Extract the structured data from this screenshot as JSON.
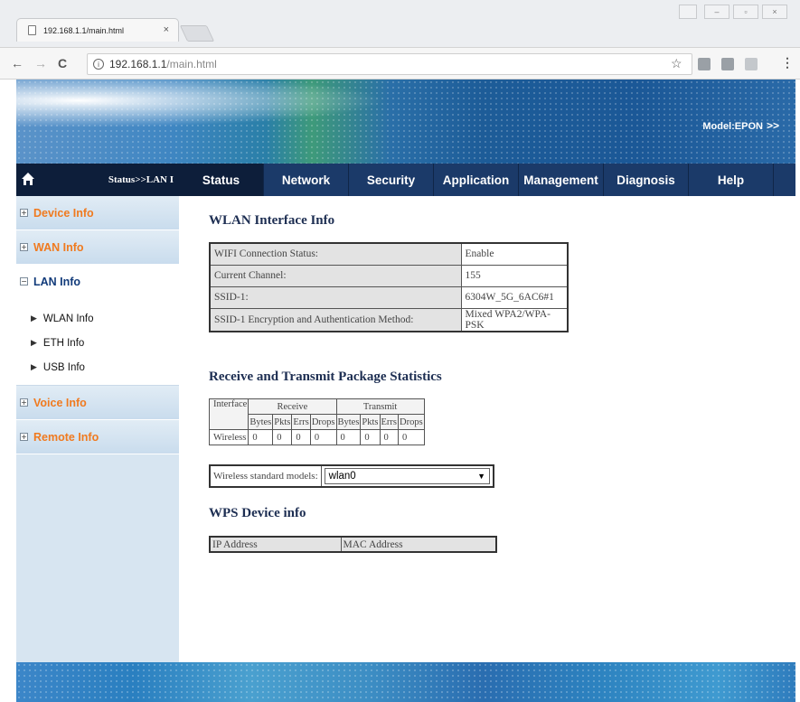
{
  "browser": {
    "tab_title": "192.168.1.1/main.html",
    "tab_close": "×",
    "url_host": "192.168.1.1",
    "url_path": "/main.html",
    "nav_back": "←",
    "nav_forward": "→",
    "nav_reload": "C",
    "info_glyph": "i",
    "star_glyph": "☆",
    "menu_glyph": "⋮",
    "win_user": "",
    "win_min": "–",
    "win_max": "▫",
    "win_close": "×"
  },
  "banner": {
    "model_label": "Model:EPON",
    "arrow": ">>"
  },
  "breadcrumb": "Status>>LAN I",
  "nav_tabs": [
    {
      "label": "Status",
      "active": true
    },
    {
      "label": "Network"
    },
    {
      "label": "Security"
    },
    {
      "label": "Application"
    },
    {
      "label": "Management"
    },
    {
      "label": "Diagnosis"
    },
    {
      "label": "Help"
    }
  ],
  "sidebar": {
    "sections": [
      {
        "label": "Device Info",
        "toggle": "+"
      },
      {
        "label": "WAN Info",
        "toggle": "+"
      },
      {
        "label": "LAN Info",
        "toggle": "−",
        "items": [
          "WLAN Info",
          "ETH Info",
          "USB Info"
        ]
      },
      {
        "label": "Voice Info",
        "toggle": "+"
      },
      {
        "label": "Remote Info",
        "toggle": "+"
      }
    ],
    "item_marker": "▶"
  },
  "wlan": {
    "title": "WLAN Interface Info",
    "rows": [
      {
        "key": "WIFI Connection Status:",
        "value": "Enable"
      },
      {
        "key": "Current Channel:",
        "value": "155"
      },
      {
        "key": "SSID-1:",
        "value": "6304W_5G_6AC6#1"
      },
      {
        "key": "SSID-1 Encryption and Authentication Method:",
        "value": "Mixed WPA2/WPA-PSK"
      }
    ]
  },
  "stats": {
    "title": "Receive and Transmit Package Statistics",
    "interface_header": "Interface",
    "receive_header": "Receive",
    "transmit_header": "Transmit",
    "sub_headers": [
      "Bytes",
      "Pkts",
      "Errs",
      "Drops",
      "Bytes",
      "Pkts",
      "Errs",
      "Drops"
    ],
    "row_label": "Wireless",
    "values": [
      "0",
      "0",
      "0",
      "0",
      "0",
      "0",
      "0",
      "0"
    ]
  },
  "wireless_models": {
    "label": "Wireless standard models:",
    "selected": "wlan0",
    "arrow": "▼"
  },
  "wps": {
    "title": "WPS Device info",
    "col_ip": "IP Address",
    "col_mac": "MAC Address"
  }
}
